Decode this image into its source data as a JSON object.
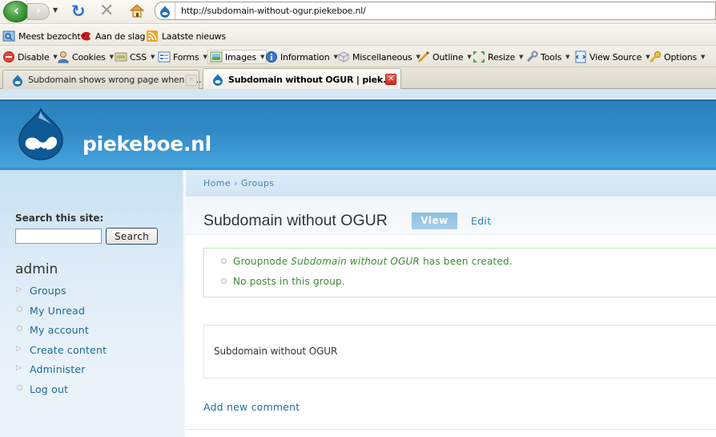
{
  "browser": {
    "url": "http://subdomain-without-ogur.piekeboe.nl/",
    "nav_icons": [
      "back-icon",
      "forward-icon",
      "history-dropdown-icon",
      "reload-icon",
      "stop-icon",
      "home-icon"
    ],
    "bookmarks": [
      {
        "label": "Meest bezocht",
        "icon": "most-visited-icon"
      },
      {
        "label": "Aan de slag",
        "icon": "getting-started-icon"
      },
      {
        "label": "Laatste nieuws",
        "icon": "rss-feed-icon"
      }
    ],
    "webdev_toolbar": [
      {
        "label": "Disable",
        "icon": "disable-icon"
      },
      {
        "label": "Cookies",
        "icon": "cookies-icon"
      },
      {
        "label": "CSS",
        "icon": "css-icon"
      },
      {
        "label": "Forms",
        "icon": "forms-icon"
      },
      {
        "label": "Images",
        "icon": "images-icon"
      },
      {
        "label": "Information",
        "icon": "information-icon"
      },
      {
        "label": "Miscellaneous",
        "icon": "miscellaneous-icon"
      },
      {
        "label": "Outline",
        "icon": "outline-icon"
      },
      {
        "label": "Resize",
        "icon": "resize-icon"
      },
      {
        "label": "Tools",
        "icon": "tools-icon"
      },
      {
        "label": "View Source",
        "icon": "view-source-icon"
      },
      {
        "label": "Options",
        "icon": "options-icon"
      }
    ],
    "tabs": [
      {
        "label": "Subdomain shows wrong page when O...",
        "active": false
      },
      {
        "label": "Subdomain without OGUR | piek...",
        "active": true
      }
    ],
    "close_glyph": "✕"
  },
  "site": {
    "name": "piekeboe.nl",
    "colors": {
      "header": "#2f88c4",
      "link": "#1a6b94",
      "message_green": "#3a8d32"
    }
  },
  "sidebar": {
    "search_label": "Search this site:",
    "search_value": "",
    "search_button": "Search",
    "user_block_title": "admin",
    "menu": [
      {
        "label": "Groups",
        "type": "collapsed"
      },
      {
        "label": "My Unread",
        "type": "leaf"
      },
      {
        "label": "My account",
        "type": "leaf"
      },
      {
        "label": "Create content",
        "type": "collapsed"
      },
      {
        "label": "Administer",
        "type": "collapsed"
      },
      {
        "label": "Log out",
        "type": "leaf"
      }
    ]
  },
  "main": {
    "breadcrumb": [
      {
        "label": "Home"
      },
      {
        "label": "Groups"
      }
    ],
    "breadcrumb_sep": "›",
    "title": "Subdomain without OGUR",
    "tabs": [
      {
        "label": "View",
        "active": true
      },
      {
        "label": "Edit",
        "active": false
      }
    ],
    "messages": [
      {
        "prefix": "Groupnode ",
        "emphasis": "Subdomain without OGUR",
        "suffix": " has been created."
      },
      {
        "prefix": "No posts in this group.",
        "emphasis": "",
        "suffix": ""
      }
    ],
    "node_body": "Subdomain without OGUR",
    "add_comment": "Add new comment"
  }
}
